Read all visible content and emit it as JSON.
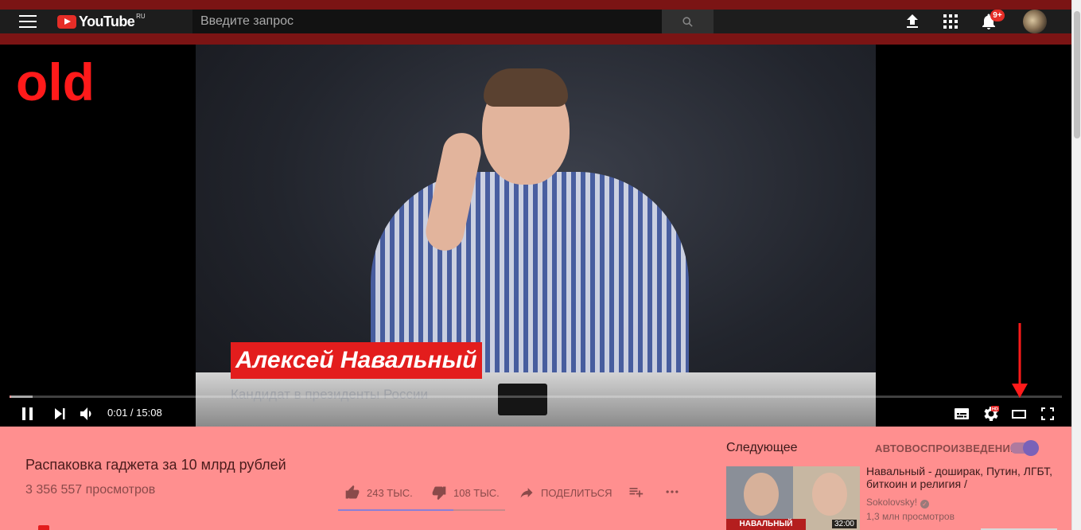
{
  "header": {
    "logo_text": "YouTube",
    "logo_region": "RU",
    "search_placeholder": "Введите запрос",
    "notification_count": "9+"
  },
  "player": {
    "annotation_label": "old",
    "caption_name": "Алексей Навальный",
    "caption_subtitle": "Кандидат в президенты России",
    "time_current": "0:01",
    "time_total": "15:08",
    "time_display": "0:01 / 15:08",
    "progress_fraction": 0.001,
    "colors": {
      "progress": "#e31d1d",
      "annotation": "#ff1a1a"
    },
    "settings_badge": "HD"
  },
  "video": {
    "title": "Распаковка гаджета за 10 млрд рублей",
    "views": "3 356 557 просмотров",
    "likes": "243 ТЫС.",
    "dislikes": "108 ТЫС.",
    "share_label": "ПОДЕЛИТЬСЯ",
    "like_ratio": 0.69
  },
  "sidebar": {
    "up_next_label": "Следующее",
    "autoplay_label": "АВТОВОСПРОИЗВЕДЕНИЕ",
    "autoplay_on": true,
    "recommendation": {
      "title": "Навальный - доширак, Путин, ЛГБТ, биткоин и религия /",
      "channel": "Sokolovsky!",
      "views": "1,3 млн просмотров",
      "thumb_text": "НАВАЛЬНЫЙ",
      "duration": "32:00"
    }
  }
}
